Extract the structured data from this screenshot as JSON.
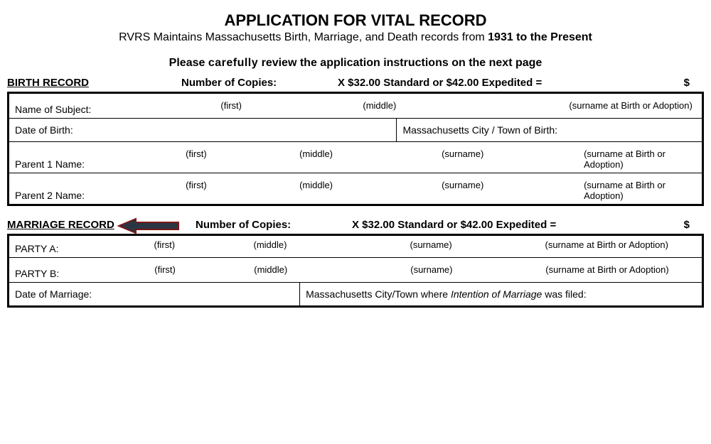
{
  "header": {
    "title": "APPLICATION FOR VITAL RECORD",
    "subtitle_pre": "RVRS Maintains Massachusetts Birth, Marriage, and Death records from ",
    "subtitle_bold": "1931 to the Present",
    "instructions_pre": "Please ",
    "instructions_bold": "carefully",
    "instructions_post": " review the application instructions on the next page"
  },
  "birth": {
    "section_label": "BIRTH RECORD",
    "copies_label": "Number of Copies:",
    "pricing": "X $32.00 Standard or $42.00 Expedited =",
    "dollar": "$",
    "name_label": "Name of Subject:",
    "sub_first": "(first)",
    "sub_middle": "(middle)",
    "sub_surname_adopt": "(surname at Birth or Adoption)",
    "sub_surname": "(surname)",
    "dob_label": "Date of Birth:",
    "city_label": "Massachusetts City / Town of Birth:",
    "parent1_label": "Parent 1 Name:",
    "parent2_label": "Parent 2 Name:"
  },
  "marriage": {
    "section_label": "MARRIAGE RECORD",
    "copies_label": "Number of Copies:",
    "pricing": "X $32.00 Standard or $42.00 Expedited =",
    "dollar": "$",
    "party_a_label": "PARTY A:",
    "party_b_label": "PARTY B:",
    "sub_first": "(first)",
    "sub_middle": "(middle)",
    "sub_surname": "(surname)",
    "sub_surname_adopt": "(surname at Birth or Adoption)",
    "dom_label": "Date of Marriage:",
    "city_label_pre": "Massachusetts City/Town where ",
    "city_label_italic": "Intention of Marriage",
    "city_label_post": " was filed:"
  }
}
